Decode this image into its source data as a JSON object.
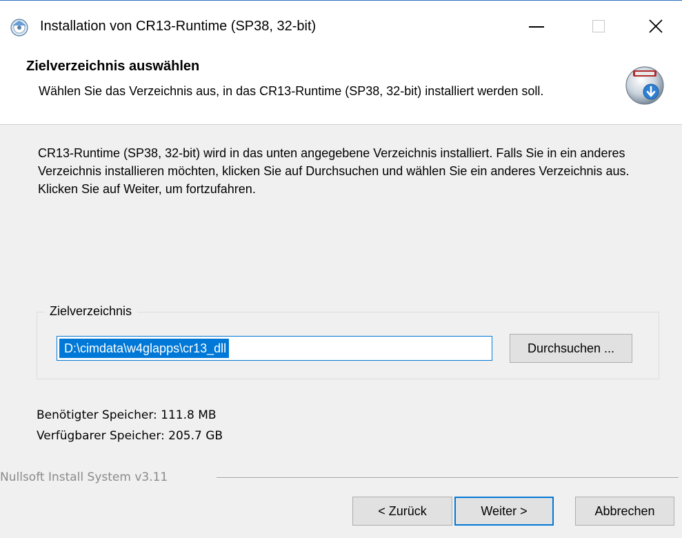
{
  "window": {
    "title": "Installation von CR13-Runtime (SP38, 32-bit)",
    "icon": "installer-disc-icon"
  },
  "titlebar_buttons": {
    "minimize_icon": "minimize-icon",
    "maximize_icon": "maximize-icon",
    "close_glyph": "✕"
  },
  "header": {
    "title": "Zielverzeichnis auswählen",
    "subtitle": "Wählen Sie das Verzeichnis aus, in das CR13-Runtime (SP38, 32-bit)  installiert werden soll.",
    "icon": "nsis-installer-icon"
  },
  "body": {
    "description": "CR13-Runtime (SP38, 32-bit)  wird in das unten angegebene Verzeichnis installiert. Falls Sie in ein anderes Verzeichnis installieren möchten, klicken Sie auf Durchsuchen und wählen Sie ein anderes Verzeichnis aus. Klicken Sie auf Weiter, um fortzufahren."
  },
  "destination": {
    "group_label": "Zielverzeichnis",
    "path_value": "D:\\cimdata\\w4glapps\\cr13_dll",
    "browse_label": "Durchsuchen ..."
  },
  "space": {
    "required": "Benötigter Speicher: 111.8 MB",
    "available": "Verfügbarer Speicher: 205.7 GB"
  },
  "footer": {
    "brand": "Nullsoft Install System v3.11",
    "back_label": "< Zurück",
    "next_label": "Weiter >",
    "cancel_label": "Abbrechen"
  },
  "colors": {
    "accent": "#0078d7",
    "window_bg": "#f0f0f0",
    "button_bg": "#e1e1e1"
  }
}
